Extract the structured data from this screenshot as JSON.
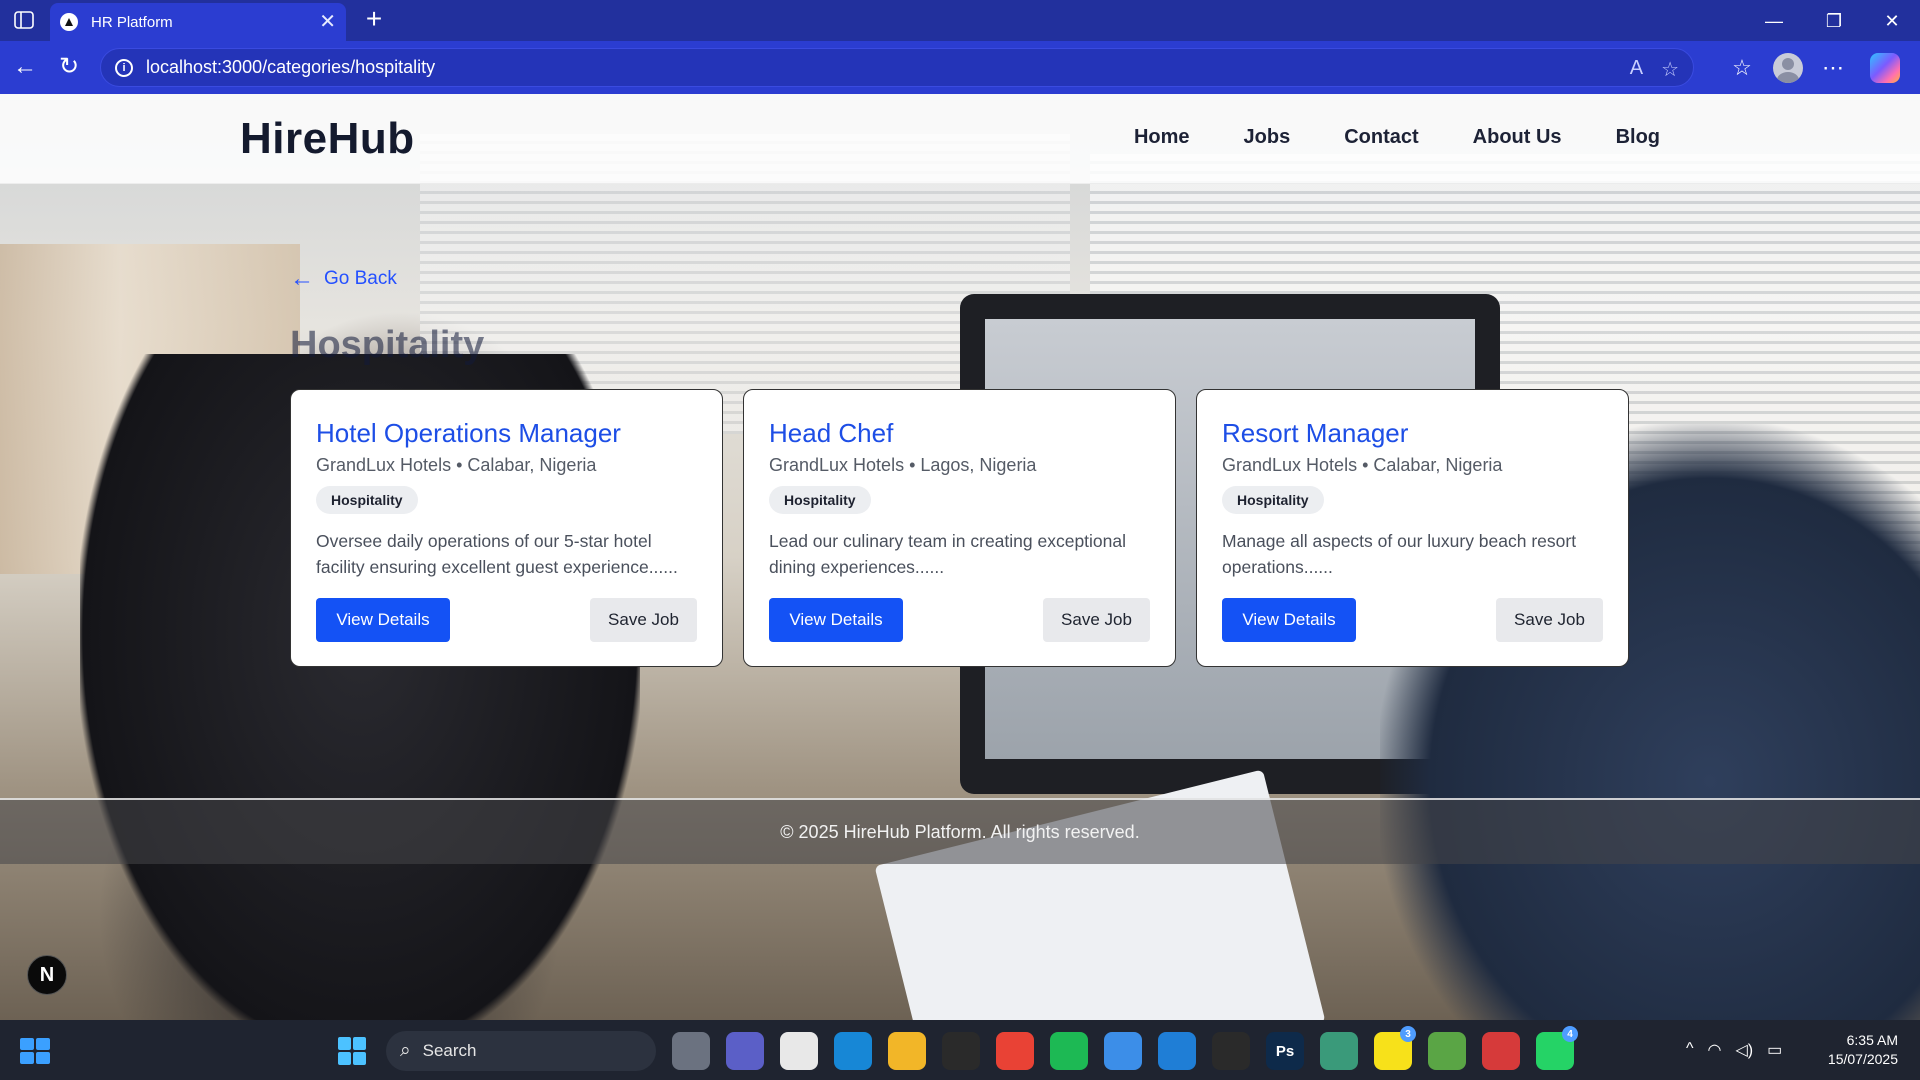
{
  "browser": {
    "tab_title": "HR Platform",
    "url": "localhost:3000/categories/hospitality",
    "accent": "#2b3dd1"
  },
  "site": {
    "logo": "HireHub",
    "nav": [
      "Home",
      "Jobs",
      "Contact",
      "About Us",
      "Blog"
    ],
    "go_back": "Go Back",
    "page_title": "Hospitality",
    "jobs": [
      {
        "title": "Hotel Operations Manager",
        "company_location": "GrandLux Hotels • Calabar, Nigeria",
        "category": "Hospitality",
        "description": "Oversee daily operations of our 5-star hotel facility ensuring excellent guest experience......",
        "view_label": "View Details",
        "save_label": "Save Job"
      },
      {
        "title": "Head Chef",
        "company_location": "GrandLux Hotels • Lagos, Nigeria",
        "category": "Hospitality",
        "description": "Lead our culinary team in creating exceptional dining experiences......",
        "view_label": "View Details",
        "save_label": "Save Job"
      },
      {
        "title": "Resort Manager",
        "company_location": "GrandLux Hotels • Calabar, Nigeria",
        "category": "Hospitality",
        "description": "Manage all aspects of our luxury beach resort operations......",
        "view_label": "View Details",
        "save_label": "Save Job"
      }
    ],
    "footer": "© 2025 HireHub Platform. All rights reserved.",
    "next_badge": "N"
  },
  "taskbar": {
    "search_label": "Search",
    "time": "6:35 AM",
    "date": "15/07/2025",
    "apps": [
      {
        "name": "task-view-icon",
        "glyph": "",
        "color": "#6b7280"
      },
      {
        "name": "teams-icon",
        "glyph": "",
        "color": "#5b5fc7"
      },
      {
        "name": "store-icon",
        "glyph": "",
        "color": "#e8e8e8"
      },
      {
        "name": "edge-icon",
        "glyph": "",
        "color": "#1787d6"
      },
      {
        "name": "file-explorer-icon",
        "glyph": "",
        "color": "#f2b628"
      },
      {
        "name": "figma-icon",
        "glyph": "",
        "color": "#2a2a2a"
      },
      {
        "name": "chrome-icon",
        "glyph": "",
        "color": "#e94235"
      },
      {
        "name": "spotify-icon",
        "glyph": "",
        "color": "#1db954"
      },
      {
        "name": "notepad-icon",
        "glyph": "",
        "color": "#3c8ee8"
      },
      {
        "name": "vscode-icon",
        "glyph": "",
        "color": "#1f7ed6"
      },
      {
        "name": "app-icon",
        "glyph": "",
        "color": "#2a2a2a"
      },
      {
        "name": "photoshop-icon",
        "glyph": "Ps",
        "color": "#0e2a4a"
      },
      {
        "name": "git-icon",
        "glyph": "",
        "color": "#3a9a7a"
      },
      {
        "name": "snapchat-icon",
        "glyph": "",
        "color": "#f7e11a",
        "badge": "3"
      },
      {
        "name": "node-icon",
        "glyph": "",
        "color": "#5aa545"
      },
      {
        "name": "app-red-icon",
        "glyph": "",
        "color": "#d63a3a"
      },
      {
        "name": "whatsapp-icon",
        "glyph": "",
        "color": "#25d366",
        "badge": "4"
      }
    ]
  }
}
